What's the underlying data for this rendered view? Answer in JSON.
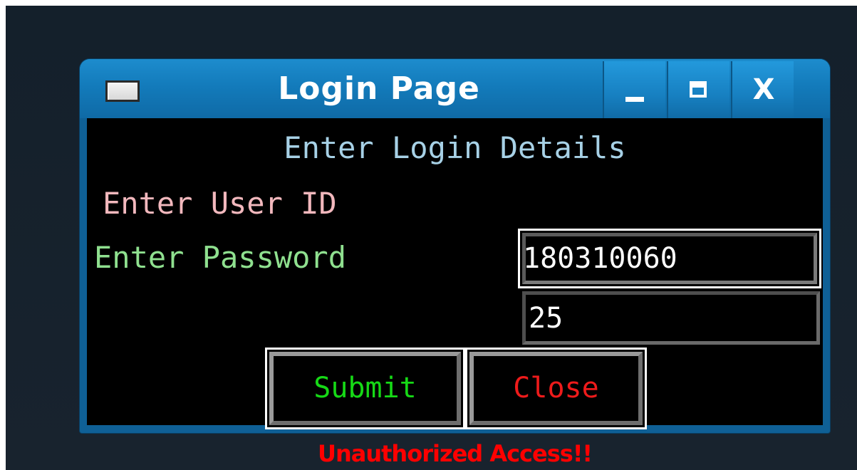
{
  "window": {
    "title": "Login Page",
    "controls": {
      "minimize_icon": "minimize-icon",
      "maximize_icon": "maximize-icon",
      "close_label": "X"
    }
  },
  "form": {
    "heading": "Enter Login Details",
    "user_id_label": "Enter User ID",
    "user_id_value": "180310060",
    "password_label": "Enter Password",
    "password_value": "25",
    "submit_label": "Submit",
    "close_label": "Close",
    "status_message": "Unauthorized Access!!"
  },
  "colors": {
    "titlebar": "#1782c3",
    "heading": "#a7d1e6",
    "user_label": "#f2b8bd",
    "password_label": "#8fe08f",
    "submit_text": "#16d916",
    "close_text": "#ee1b1b",
    "status": "#ff0000"
  }
}
